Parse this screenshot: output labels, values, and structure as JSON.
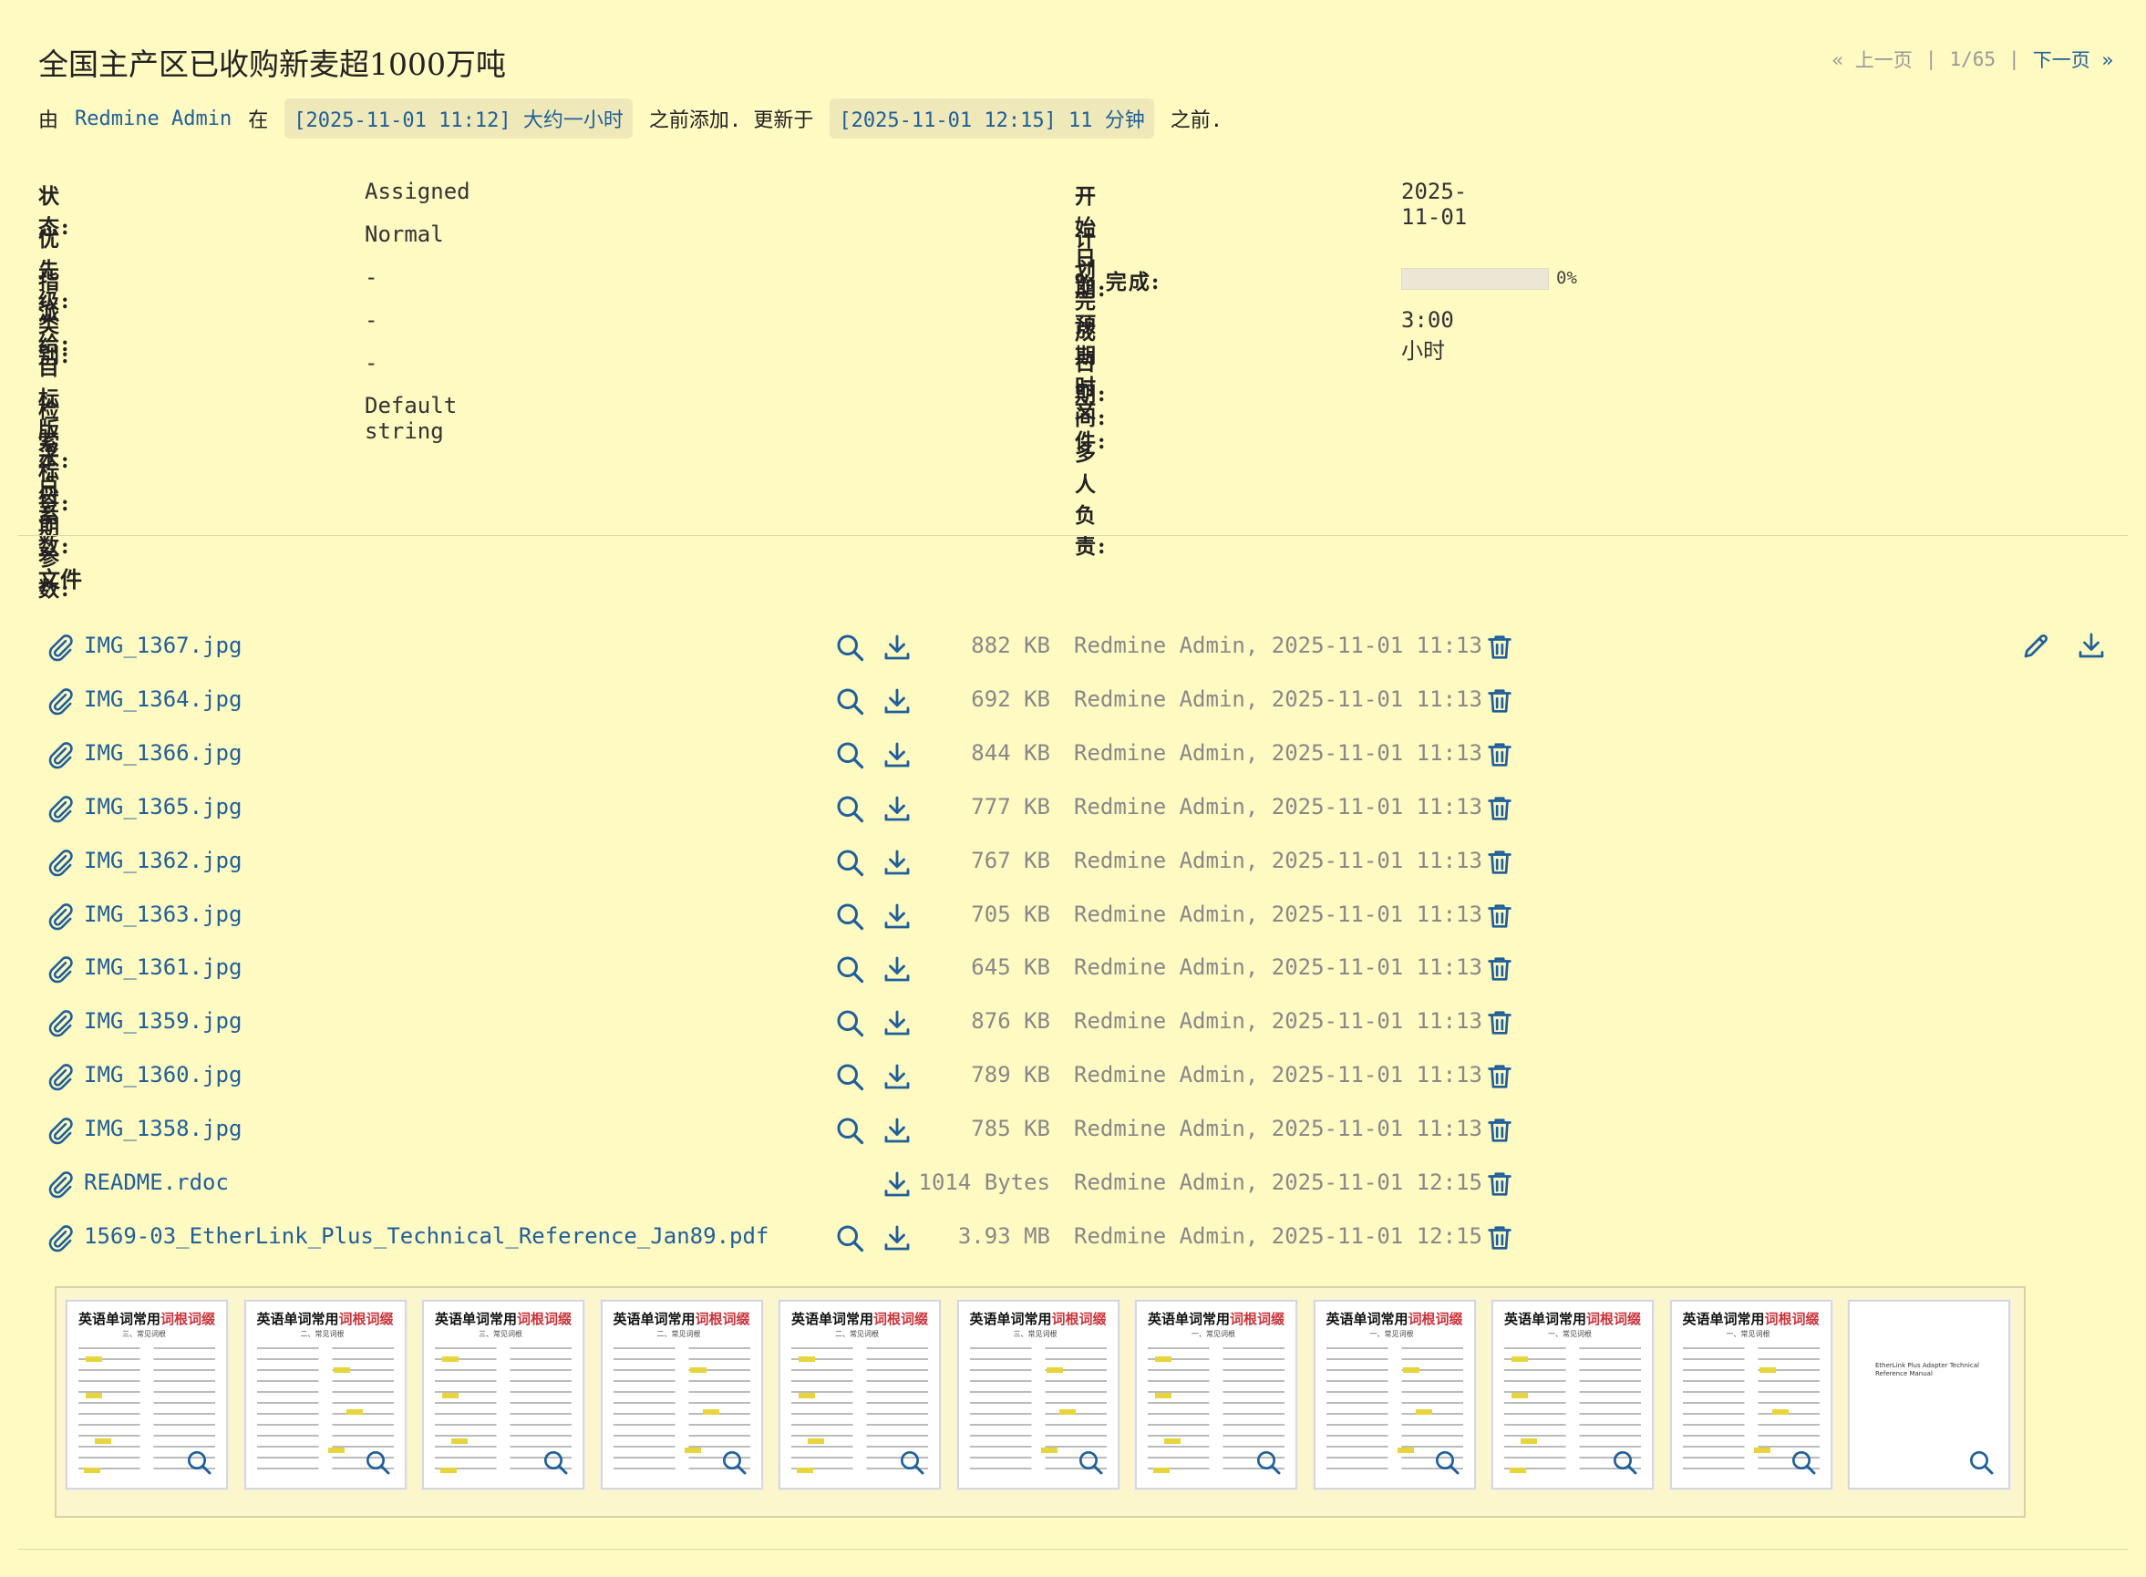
{
  "issue": {
    "title": "全国主产区已收购新麦超1000万吨",
    "pager": {
      "prev": "« 上一页",
      "sep": "|",
      "position": "1/65",
      "sep2": "|",
      "next": "下一页 »"
    },
    "byline": {
      "prefix": "由",
      "author": "Redmine Admin",
      "at": "在",
      "created": "[2025-11-01 11:12] 大约一小时",
      "added_text": "之前添加. 更新于",
      "updated": "[2025-11-01 12:15] 11 分钟",
      "suffix": "之前."
    }
  },
  "attributes": {
    "left": [
      {
        "label": "状态:",
        "value": "Assigned"
      },
      {
        "label": "优先级:",
        "value": "Normal"
      },
      {
        "label": "指派给:",
        "value": "-"
      },
      {
        "label": "类别:",
        "value": "-"
      },
      {
        "label": "目标版本:",
        "value": "-"
      },
      {
        "label": "检索标签:",
        "value": "Default string"
      },
      {
        "label": "浮点系数:",
        "value": ""
      },
      {
        "label": "日期参数:",
        "value": ""
      }
    ],
    "right": [
      {
        "label": "开始日期:",
        "value": "2025-11-01"
      },
      {
        "label": "计划完成日期:",
        "value": ""
      },
      {
        "label": "% 完成:",
        "value": "0%",
        "progress": 0
      },
      {
        "label": "预期时间:",
        "value": "3:00 小时"
      },
      {
        "label": "",
        "value": ""
      },
      {
        "label": "文件:",
        "value": ""
      },
      {
        "label": "多人负责:",
        "value": ""
      }
    ]
  },
  "files": {
    "heading": "文件",
    "items": [
      {
        "name": "IMG_1367.jpg",
        "size": "882 KB",
        "meta": "Redmine Admin, 2025-11-01 11:13",
        "preview": true
      },
      {
        "name": "IMG_1364.jpg",
        "size": "692 KB",
        "meta": "Redmine Admin, 2025-11-01 11:13",
        "preview": true
      },
      {
        "name": "IMG_1366.jpg",
        "size": "844 KB",
        "meta": "Redmine Admin, 2025-11-01 11:13",
        "preview": true
      },
      {
        "name": "IMG_1365.jpg",
        "size": "777 KB",
        "meta": "Redmine Admin, 2025-11-01 11:13",
        "preview": true
      },
      {
        "name": "IMG_1362.jpg",
        "size": "767 KB",
        "meta": "Redmine Admin, 2025-11-01 11:13",
        "preview": true
      },
      {
        "name": "IMG_1363.jpg",
        "size": "705 KB",
        "meta": "Redmine Admin, 2025-11-01 11:13",
        "preview": true
      },
      {
        "name": "IMG_1361.jpg",
        "size": "645 KB",
        "meta": "Redmine Admin, 2025-11-01 11:13",
        "preview": true
      },
      {
        "name": "IMG_1359.jpg",
        "size": "876 KB",
        "meta": "Redmine Admin, 2025-11-01 11:13",
        "preview": true
      },
      {
        "name": "IMG_1360.jpg",
        "size": "789 KB",
        "meta": "Redmine Admin, 2025-11-01 11:13",
        "preview": true
      },
      {
        "name": "IMG_1358.jpg",
        "size": "785 KB",
        "meta": "Redmine Admin, 2025-11-01 11:13",
        "preview": true
      },
      {
        "name": "README.rdoc",
        "size": "1014 Bytes",
        "meta": "Redmine Admin, 2025-11-01 12:15",
        "preview": false
      },
      {
        "name": "1569-03_EtherLink_Plus_Technical_Reference_Jan89.pdf",
        "size": "3.93 MB",
        "meta": "Redmine Admin, 2025-11-01 12:15",
        "preview": true
      }
    ]
  },
  "thumbnails": {
    "doc_title_a": "英语单词常用",
    "doc_title_b": "词根词缀",
    "pdf_title": "EtherLink Plus Adapter Technical Reference Manual",
    "subs": [
      "三、常见词根",
      "二、常见词根",
      "三、常见词根",
      "二、常见词根",
      "二、常见词根",
      "三、常见词根",
      "一、常见词根",
      "一、常见词根",
      "一、常见词根",
      "一、常见词根"
    ]
  },
  "colors": {
    "background": "#fff9c2",
    "link": "#1f5f9a",
    "muted": "#888888"
  },
  "icons": {
    "attachment": "paperclip-icon",
    "preview": "magnifier-icon",
    "download": "download-icon",
    "delete": "trash-icon",
    "edit": "pencil-icon"
  }
}
